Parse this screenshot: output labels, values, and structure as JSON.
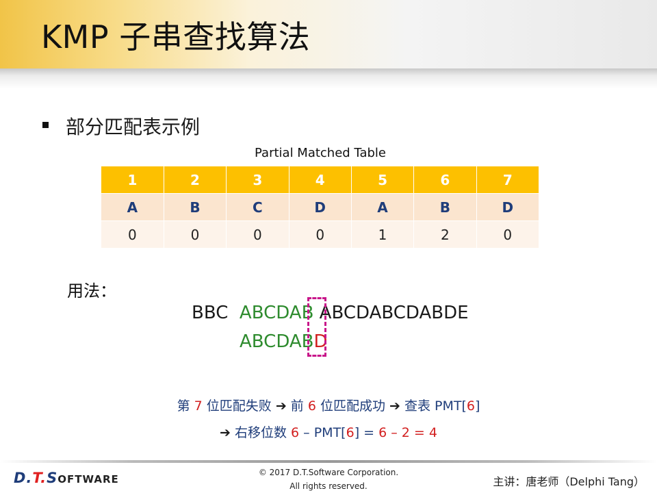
{
  "slide": {
    "title": "KMP 子串查找算法",
    "subtitle": "部分匹配表示例",
    "table_caption": "Partial Matched Table",
    "table": {
      "header": [
        "1",
        "2",
        "3",
        "4",
        "5",
        "6",
        "7"
      ],
      "chars": [
        "A",
        "B",
        "C",
        "D",
        "A",
        "B",
        "D"
      ],
      "values": [
        "0",
        "0",
        "0",
        "0",
        "1",
        "2",
        "0"
      ]
    },
    "usage_label": "用法：",
    "text_line": {
      "prefix": "BBC",
      "matched": "ABCDAB",
      "rest": " ABCDABCDABDE"
    },
    "pattern_line": {
      "matched": "ABCDAB",
      "mismatch": "D"
    },
    "explanation1": {
      "p1": "第 ",
      "n1": "7",
      "p2": " 位匹配失败 ",
      "arrow": "➔",
      "p3": " 前 ",
      "n2": "6",
      "p4": " 位匹配成功 ",
      "arrow2": "➔",
      "p5": " 查表 PMT[",
      "n3": "6",
      "p6": "]"
    },
    "explanation2": {
      "arrow": "➔",
      "p1": " 右移位数 ",
      "n1": "6",
      "p2": " – PMT[",
      "n2": "6",
      "p3": "]  = ",
      "n3": "6 – 2 = 4"
    }
  },
  "footer": {
    "logo_d": "D.",
    "logo_t": "T.",
    "logo_s": "S",
    "logo_rest": "OFTWARE",
    "copyright_line1": "© 2017 D.T.Software Corporation.",
    "copyright_line2": "All rights reserved.",
    "lecturer": "主讲：唐老师（Delphi Tang）"
  }
}
